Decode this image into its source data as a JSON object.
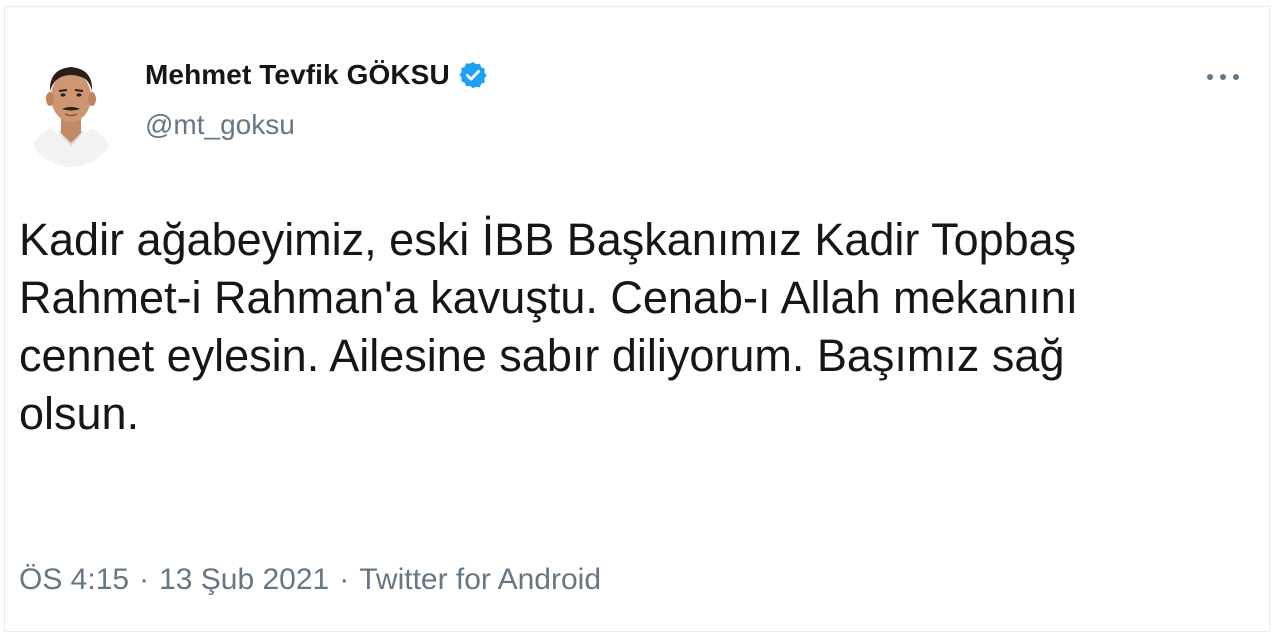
{
  "user": {
    "display_name": "Mehmet Tevfik GÖKSU",
    "handle": "@mt_goksu",
    "verified": true,
    "verified_color": "#1da1f2"
  },
  "icons": {
    "avatar": "profile-photo",
    "verified": "verified-badge-icon",
    "more": "more-options-icon"
  },
  "tweet": {
    "text_lines": [
      "Kadir ağabeyimiz, eski İBB Başkanımız Kadir Topbaş",
      "Rahmet-i Rahman'a kavuştu. Cenab-ı Allah mekanını",
      "cennet eylesin. Ailesine sabır diliyorum. Başımız sağ",
      "olsun."
    ]
  },
  "meta": {
    "time": "ÖS 4:15",
    "separator": "·",
    "date": "13 Şub 2021",
    "source": "Twitter for Android"
  },
  "colors": {
    "text": "#14171a",
    "secondary": "#657786",
    "border": "#e6ecf0"
  }
}
